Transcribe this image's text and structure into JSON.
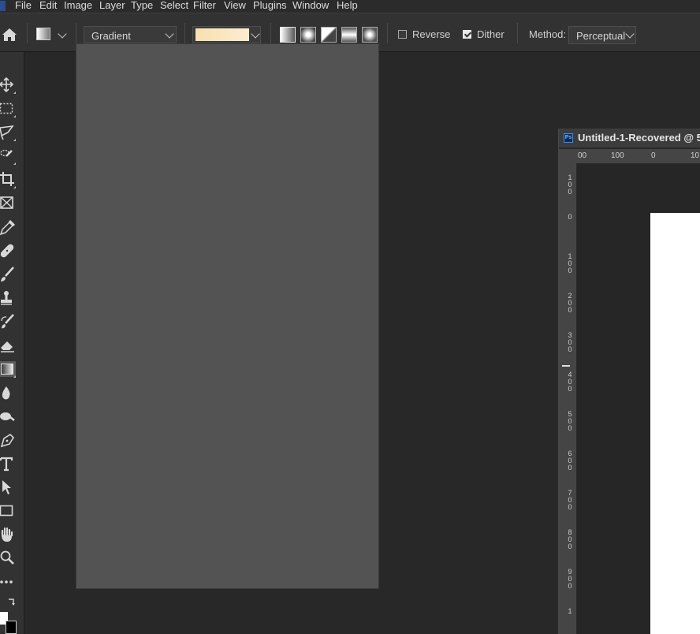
{
  "menu": {
    "items": [
      "File",
      "Edit",
      "Image",
      "Layer",
      "Type",
      "Select",
      "Filter",
      "View",
      "Plugins",
      "Window",
      "Help"
    ]
  },
  "options": {
    "gradient_preset_label": "Gradient",
    "gradient_colors": [
      "#f7e0b0",
      "#fbedd0"
    ],
    "gradient_types": [
      "linear",
      "radial",
      "angle",
      "reflected",
      "diamond"
    ],
    "reverse_label": "Reverse",
    "reverse_checked": false,
    "dither_label": "Dither",
    "dither_checked": true,
    "method_label": "Method:",
    "method_value": "Perceptual"
  },
  "tools": [
    "move-tool",
    "marquee-tool",
    "lasso-tool",
    "quick-selection-tool",
    "crop-tool",
    "frame-tool",
    "eyedropper-tool",
    "healing-brush-tool",
    "brush-tool",
    "clone-stamp-tool",
    "history-brush-tool",
    "eraser-tool",
    "gradient-tool",
    "blur-tool",
    "dodge-tool",
    "pen-tool",
    "type-tool",
    "path-selection-tool",
    "rectangle-tool",
    "hand-tool",
    "zoom-tool",
    "more-tools"
  ],
  "active_tool": "gradient-tool",
  "colors": {
    "foreground": "#ffffff",
    "background": "#000000"
  },
  "document": {
    "tab_title": "Untitled-1-Recovered @ 5",
    "ps_badge": "Ps",
    "ruler_top": [
      "00",
      "100",
      "0",
      "10"
    ],
    "ruler_left": [
      "1\n0\n0",
      "0",
      "1\n0\n0",
      "2\n0\n0",
      "3\n0\n0",
      "4\n0\n0",
      "5\n0\n0",
      "6\n0\n0",
      "7\n0\n0",
      "8\n0\n0",
      "9\n0\n0",
      "1"
    ]
  }
}
